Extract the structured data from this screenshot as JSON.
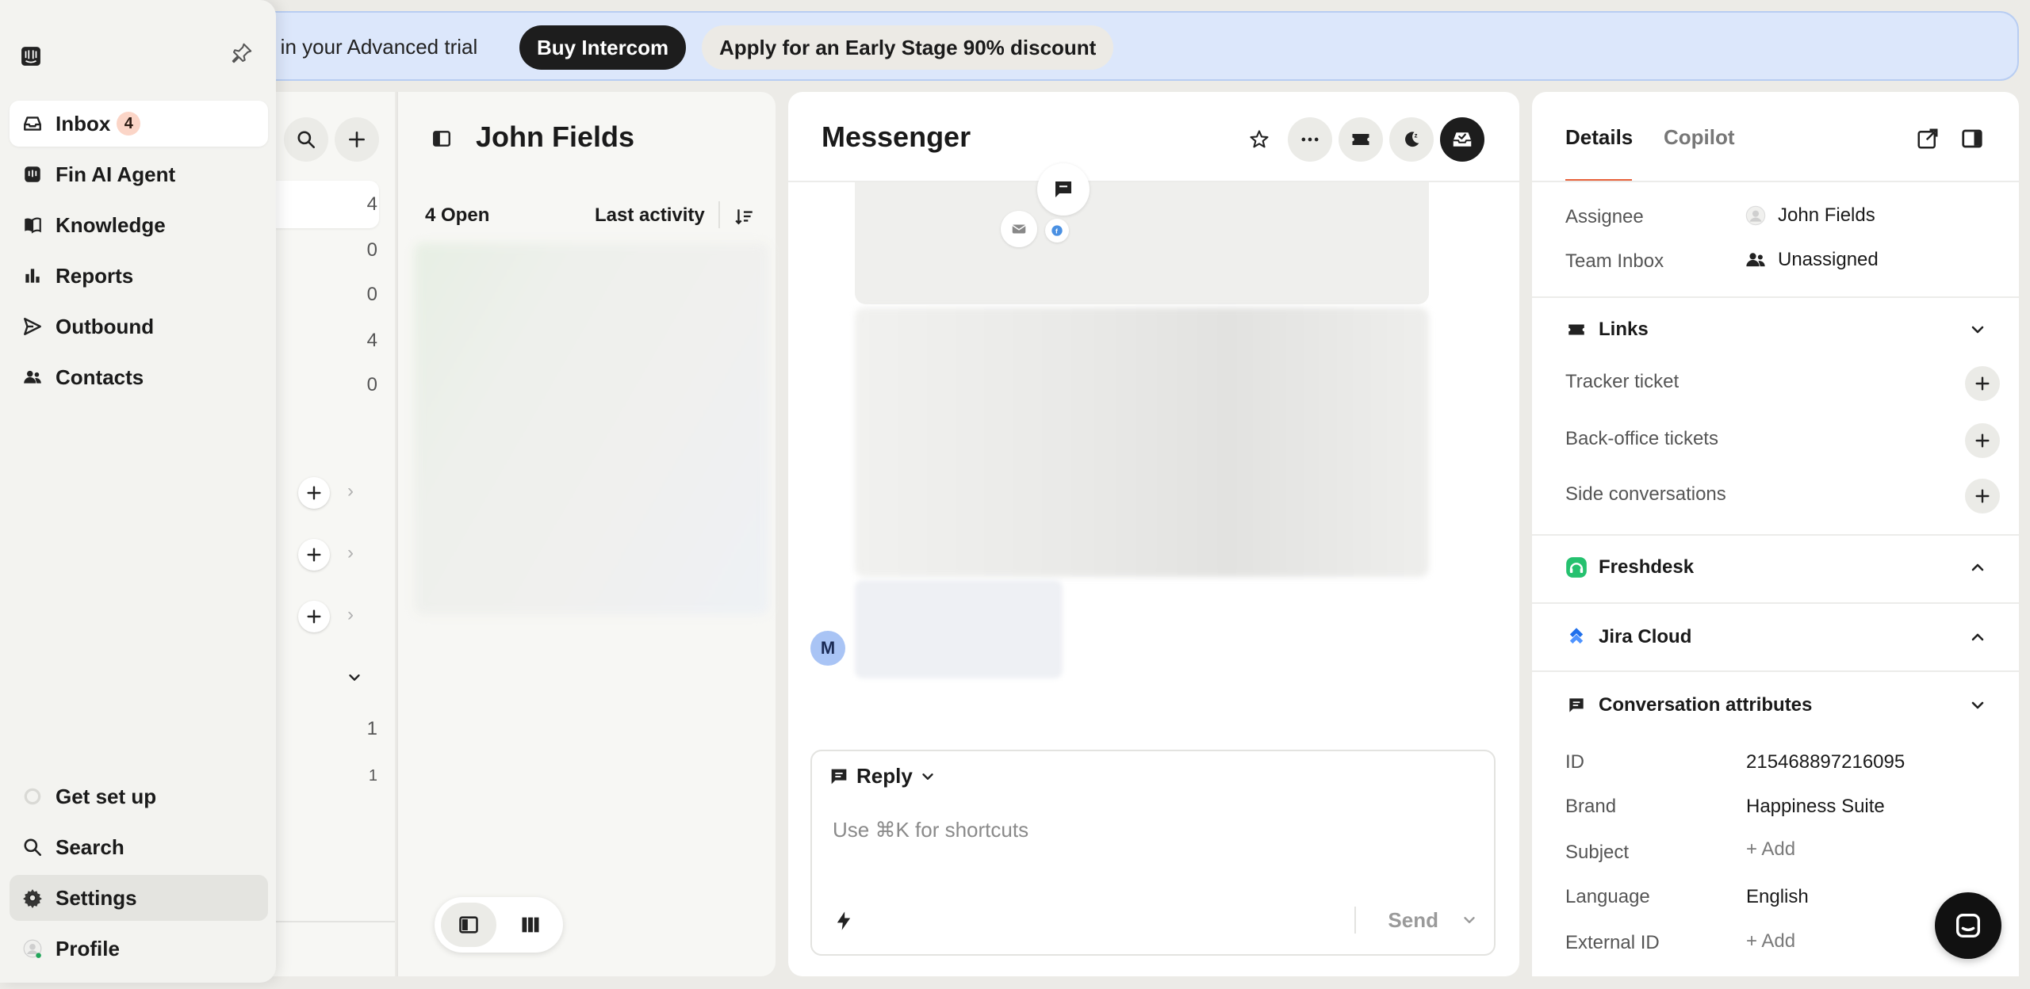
{
  "banner": {
    "text": "ft in your Advanced trial",
    "buy_label": "Buy Intercom",
    "discount_label": "Apply for an Early Stage 90% discount"
  },
  "sidebar": {
    "items": [
      {
        "label": "Inbox",
        "badge": "4"
      },
      {
        "label": "Fin AI Agent"
      },
      {
        "label": "Knowledge"
      },
      {
        "label": "Reports"
      },
      {
        "label": "Outbound"
      },
      {
        "label": "Contacts"
      }
    ],
    "bottom": [
      {
        "label": "Get set up"
      },
      {
        "label": "Search"
      },
      {
        "label": "Settings"
      },
      {
        "label": "Profile"
      }
    ]
  },
  "inbox_panel": {
    "counts": [
      "4",
      "0",
      "0",
      "4",
      "0"
    ],
    "lower_counts": [
      "1",
      "1"
    ]
  },
  "list": {
    "title": "John Fields",
    "open_count": "4 Open",
    "sort_label": "Last activity"
  },
  "conversation": {
    "title": "Messenger",
    "avatar_initial": "M",
    "reply_label": "Reply",
    "composer_placeholder": "Use ⌘K for shortcuts",
    "send_label": "Send"
  },
  "details": {
    "tabs": [
      "Details",
      "Copilot"
    ],
    "assignee_label": "Assignee",
    "assignee_value": "John Fields",
    "team_label": "Team Inbox",
    "team_value": "Unassigned",
    "links_title": "Links",
    "links": [
      "Tracker ticket",
      "Back-office tickets",
      "Side conversations"
    ],
    "freshdesk_title": "Freshdesk",
    "jira_title": "Jira Cloud",
    "conv_attr_title": "Conversation attributes",
    "attributes": [
      {
        "label": "ID",
        "value": "215468897216095"
      },
      {
        "label": "Brand",
        "value": "Happiness Suite"
      },
      {
        "label": "Subject",
        "value": "+ Add"
      },
      {
        "label": "Language",
        "value": "English"
      },
      {
        "label": "External ID",
        "value": "+ Add"
      }
    ]
  },
  "colors": {
    "accent_tab": "#e8623b",
    "badge_bg": "#fbd5c7",
    "banner_bg": "#dce7fb",
    "freshdesk": "#25c16f",
    "jira": "#1f6feb"
  }
}
